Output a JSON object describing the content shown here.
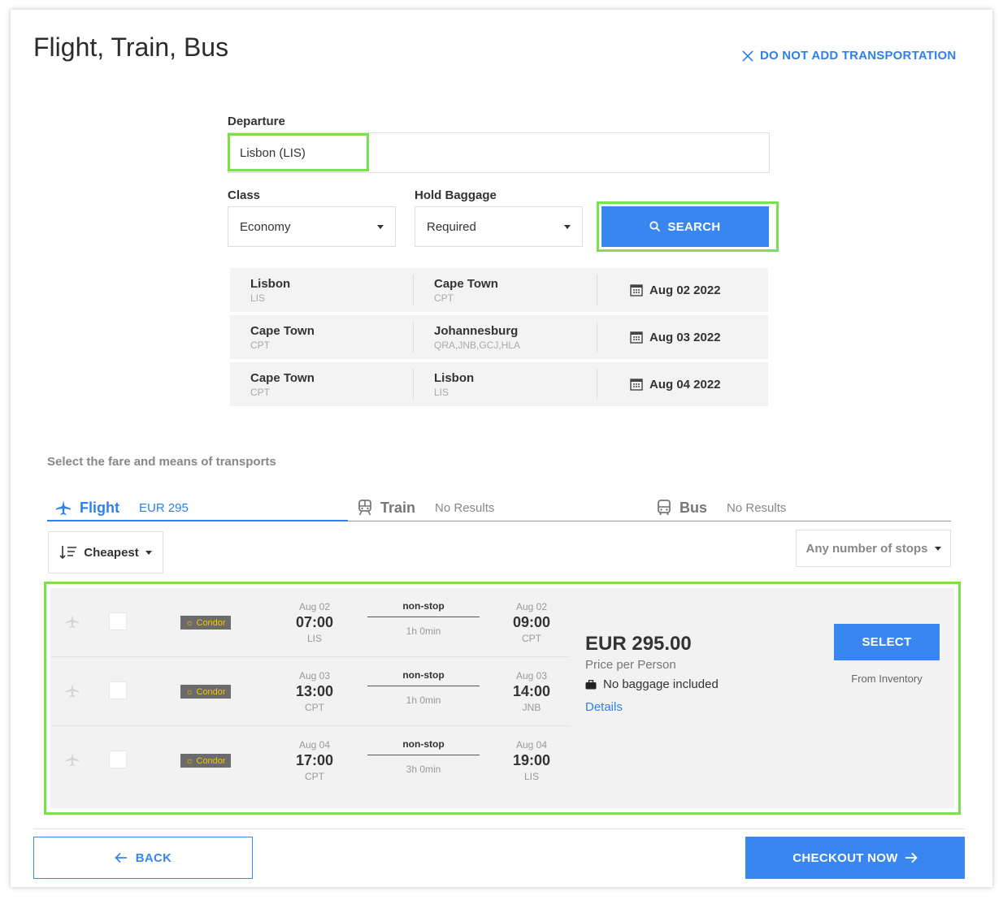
{
  "page": {
    "title": "Flight, Train, Bus",
    "skip_label": "DO NOT ADD TRANSPORTATION"
  },
  "search": {
    "departure_label": "Departure",
    "departure_value": "Lisbon (LIS)",
    "class_label": "Class",
    "class_value": "Economy",
    "baggage_label": "Hold Baggage",
    "baggage_value": "Required",
    "search_button": "SEARCH"
  },
  "legs": [
    {
      "from_city": "Lisbon",
      "from_code": "LIS",
      "to_city": "Cape Town",
      "to_code": "CPT",
      "date": "Aug 02 2022"
    },
    {
      "from_city": "Cape Town",
      "from_code": "CPT",
      "to_city": "Johannesburg",
      "to_code": "QRA,JNB,GCJ,HLA",
      "date": "Aug 03 2022"
    },
    {
      "from_city": "Cape Town",
      "from_code": "CPT",
      "to_city": "Lisbon",
      "to_code": "LIS",
      "date": "Aug 04 2022"
    }
  ],
  "fare_section": {
    "header": "Select the fare and means of transports",
    "tabs": [
      {
        "name": "Flight",
        "info": "EUR 295"
      },
      {
        "name": "Train",
        "info": "No Results"
      },
      {
        "name": "Bus",
        "info": "No Results"
      }
    ],
    "sort_label": "Cheapest",
    "stops_filter": "Any number of stops"
  },
  "result": {
    "airline": "Condor",
    "flights": [
      {
        "dep_date": "Aug 02",
        "dep_time": "07:00",
        "dep_code": "LIS",
        "stops": "non-stop",
        "duration": "1h 0min",
        "arr_date": "Aug 02",
        "arr_time": "09:00",
        "arr_code": "CPT"
      },
      {
        "dep_date": "Aug 03",
        "dep_time": "13:00",
        "dep_code": "CPT",
        "stops": "non-stop",
        "duration": "1h 0min",
        "arr_date": "Aug 03",
        "arr_time": "14:00",
        "arr_code": "JNB"
      },
      {
        "dep_date": "Aug 04",
        "dep_time": "17:00",
        "dep_code": "CPT",
        "stops": "non-stop",
        "duration": "3h 0min",
        "arr_date": "Aug 04",
        "arr_time": "19:00",
        "arr_code": "LIS"
      }
    ],
    "price": "EUR 295.00",
    "price_note": "Price per Person",
    "baggage": "No baggage included",
    "details_link": "Details",
    "select_button": "SELECT",
    "source": "From Inventory"
  },
  "footer": {
    "back_button": "BACK",
    "checkout_button": "CHECKOUT NOW"
  },
  "colors": {
    "accent": "#3a86f0",
    "highlight": "#7be14a",
    "panel": "#f2f2f2"
  }
}
